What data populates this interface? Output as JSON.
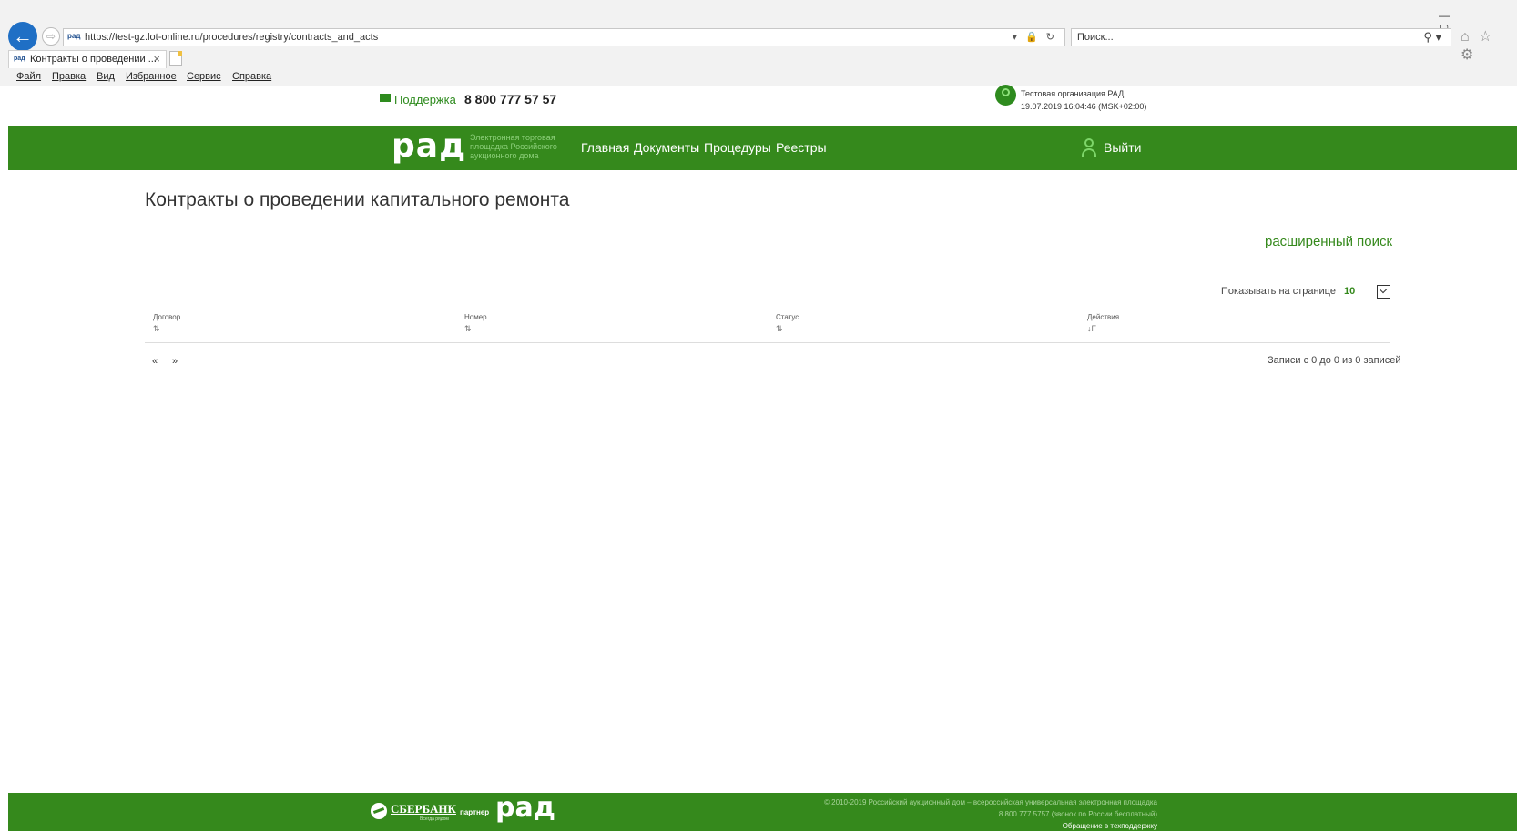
{
  "browser": {
    "url": "https://test-gz.lot-online.ru/procedures/registry/contracts_and_acts",
    "search_placeholder": "Поиск...",
    "tab_title": "Контракты о проведении ...",
    "menu": [
      "Файл",
      "Правка",
      "Вид",
      "Избранное",
      "Сервис",
      "Справка"
    ],
    "site_favicon": "рад",
    "icons": [
      "back-arrow-icon",
      "forward-arrow-icon",
      "lock-icon",
      "refresh-icon",
      "search-icon",
      "home-icon",
      "star-icon",
      "gear-icon"
    ]
  },
  "header": {
    "support_label": "Поддержка",
    "phone": "8 800 777 57 57",
    "org_name": "Тестовая организация РАД",
    "datetime": "19.07.2019 16:04:46 (MSK+02:00)"
  },
  "nav": {
    "logo": "рад",
    "logo_subtitle": "Электронная торговая площадка Российского аукционного дома",
    "links": [
      "Главная",
      "Документы",
      "Процедуры",
      "Реестры"
    ],
    "logout": "Выйти",
    "colors": {
      "brand_green": "#35891c"
    }
  },
  "main": {
    "title": "Контракты о проведении капитального ремонта",
    "advanced_search": "расширенный поиск",
    "per_page_label": "Показывать на странице",
    "per_page_value": "10",
    "columns": [
      "Договор",
      "Номер",
      "Статус",
      "Действия"
    ],
    "sort_glyphs": [
      "⇅",
      "⇅",
      "⇅",
      "↓F"
    ],
    "pagination": {
      "prev": "«",
      "next": "»"
    },
    "records_info": "Записи с 0 до 0 из 0 записей"
  },
  "footer": {
    "sber_name": "СБЕРБАНК",
    "sber_slogan": "Всегда рядом",
    "partner_label": "партнер",
    "logo": "рад",
    "copyright": "© 2010-2019 Российский аукционный дом – всероссийская универсальная электронная площадка",
    "phone_line": "8 800 777 5757 (звонок по России бесплатный)",
    "support_link": "Обращение в техподдержку"
  }
}
